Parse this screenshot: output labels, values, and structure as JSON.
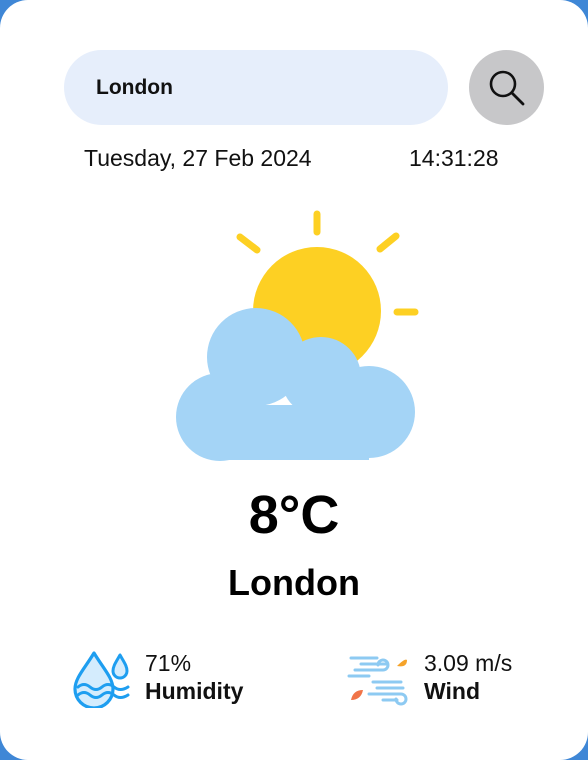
{
  "search": {
    "value": "London",
    "button_icon": "search-icon"
  },
  "datetime": {
    "date": "Tuesday, 27 Feb 2024",
    "time": "14:31:28"
  },
  "weather": {
    "icon": "partly-cloudy-icon",
    "temperature": "8°C",
    "city": "London"
  },
  "stats": {
    "humidity": {
      "value": "71%",
      "label": "Humidity",
      "icon": "humidity-icon"
    },
    "wind": {
      "value": "3.09 m/s",
      "label": "Wind",
      "icon": "wind-icon"
    }
  },
  "colors": {
    "background": "#3f87d6",
    "card": "#ffffff",
    "search_field": "#e6eefb",
    "search_button": "#c7c7c9",
    "sun": "#fdd023",
    "cloud": "#a4d4f6",
    "humidity_icon": "#1e9ef0",
    "wind_lines": "#8dcaf2",
    "leaf_orange": "#f5a32a",
    "leaf_red": "#f07448"
  }
}
